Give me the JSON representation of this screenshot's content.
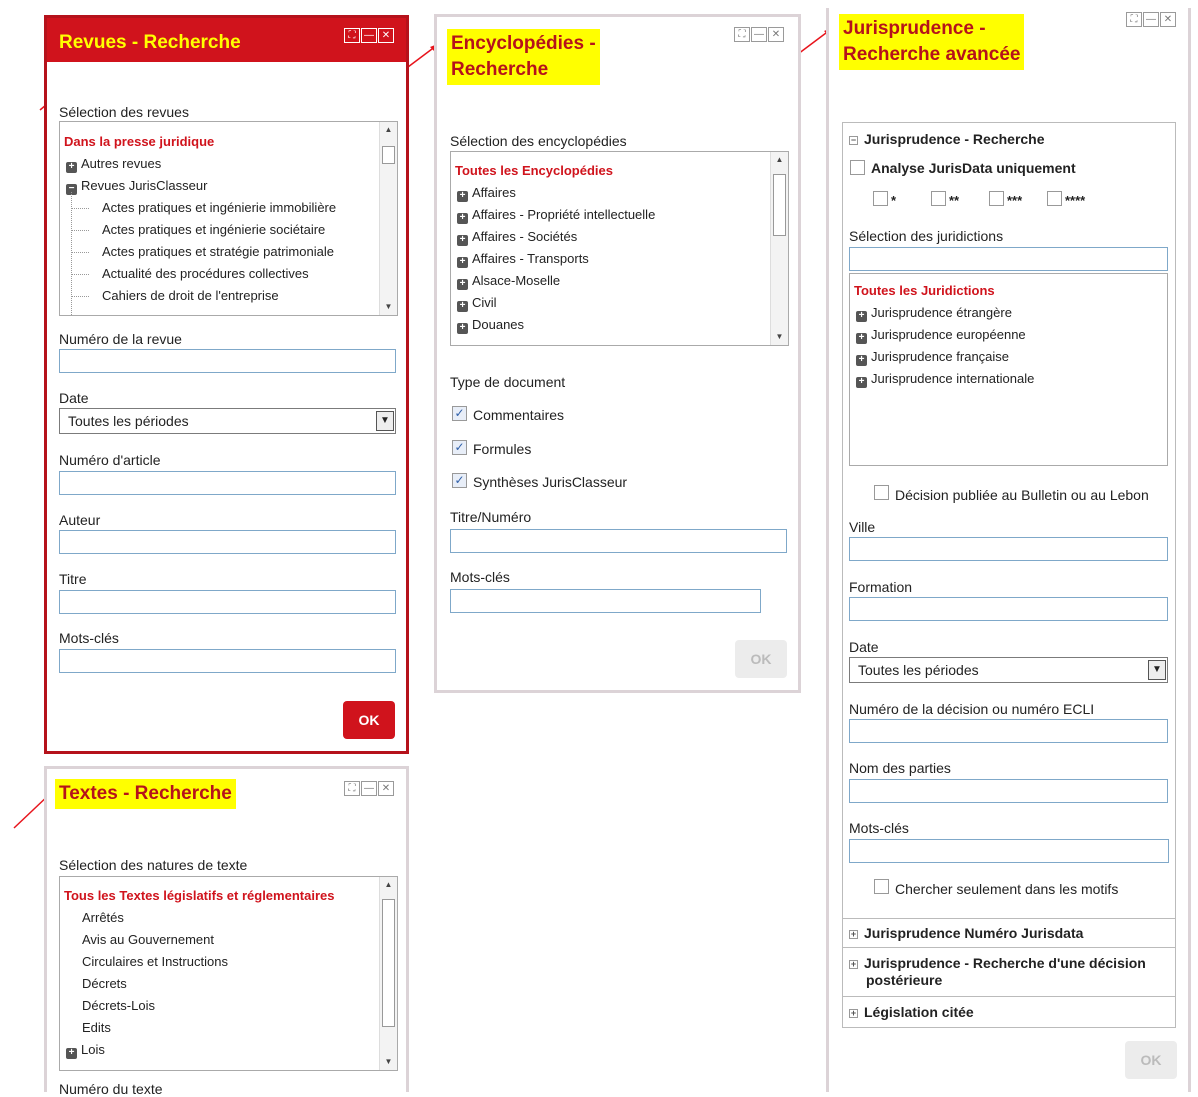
{
  "revues": {
    "title": "Revues - Recherche",
    "selection_label": "Sélection des revues",
    "tree": {
      "root": "Dans la presse juridique",
      "groups": [
        "Autres revues",
        "Revues JurisClasseur"
      ],
      "children": [
        "Actes pratiques et ingénierie immobilière",
        "Actes pratiques et ingénierie sociétaire",
        "Actes pratiques et stratégie patrimoniale",
        "Actualité des procédures collectives",
        "Cahiers de droit de l'entreprise"
      ]
    },
    "numero_revue_label": "Numéro de la revue",
    "date_label": "Date",
    "date_value": "Toutes les périodes",
    "numero_article_label": "Numéro d'article",
    "auteur_label": "Auteur",
    "titre_label": "Titre",
    "motscles_label": "Mots-clés",
    "ok_label": "OK"
  },
  "encyclopedies": {
    "title_line1": "Encyclopédies -",
    "title_line2": "Recherche",
    "selection_label": "Sélection des encyclopédies",
    "tree": {
      "root": "Toutes les Encyclopédies",
      "items": [
        "Affaires",
        "Affaires - Propriété intellectuelle",
        "Affaires - Sociétés",
        "Affaires - Transports",
        "Alsace-Moselle",
        "Civil",
        "Douanes"
      ]
    },
    "type_label": "Type de document",
    "types": [
      {
        "label": "Commentaires",
        "checked": true
      },
      {
        "label": "Formules",
        "checked": true
      },
      {
        "label": "Synthèses JurisClasseur",
        "checked": true
      }
    ],
    "titre_numero_label": "Titre/Numéro",
    "motscles_label": "Mots-clés",
    "ok_label": "OK"
  },
  "jurisprudence": {
    "title_line1": "Jurisprudence -",
    "title_line2": "Recherche avancée",
    "section1_title": "Jurisprudence - Recherche",
    "analyse_label": "Analyse JurisData uniquement",
    "stars": [
      "*",
      "**",
      "***",
      "****"
    ],
    "selection_label": "Sélection des juridictions",
    "tree": {
      "root": "Toutes les Juridictions",
      "items": [
        "Jurisprudence étrangère",
        "Jurisprudence européenne",
        "Jurisprudence française",
        "Jurisprudence internationale"
      ]
    },
    "bulletin_label": "Décision publiée au Bulletin ou au Lebon",
    "ville_label": "Ville",
    "formation_label": "Formation",
    "date_label": "Date",
    "date_value": "Toutes les périodes",
    "numero_label": "Numéro de la décision ou numéro ECLI",
    "parties_label": "Nom des parties",
    "motscles_label": "Mots-clés",
    "motifs_label": "Chercher seulement dans les motifs",
    "section2_title": "Jurisprudence Numéro Jurisdata",
    "section3_title_line1": "Jurisprudence - Recherche d'une décision",
    "section3_title_line2": "postérieure",
    "section4_title": "Législation citée",
    "ok_label": "OK"
  },
  "textes": {
    "title": "Textes - Recherche",
    "selection_label": "Sélection des natures de texte",
    "tree": {
      "root": "Tous les Textes législatifs et réglementaires",
      "items": [
        "Arrêtés",
        "Avis au Gouvernement",
        "Circulaires et Instructions",
        "Décrets",
        "Décrets-Lois",
        "Edits"
      ],
      "group": "Lois"
    },
    "numero_label": "Numéro du texte"
  },
  "annotation_color": "#e8141c",
  "highlight_color": "#ffff00"
}
